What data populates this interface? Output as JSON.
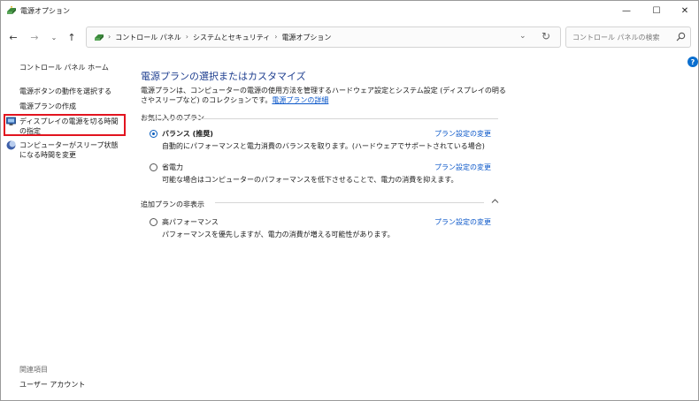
{
  "window": {
    "title": "電源オプション",
    "minimize": "—",
    "maximize": "☐",
    "close": "✕"
  },
  "nav": {
    "back": "←",
    "forward": "→",
    "recent": "⌄",
    "up": "↑",
    "breadcrumbs": [
      "コントロール パネル",
      "システムとセキュリティ",
      "電源オプション"
    ],
    "separator": "›",
    "dropdown": "⌄",
    "refresh": "↻",
    "search_placeholder": "コントロール パネルの検索"
  },
  "help": "?",
  "sidebar": {
    "home": "コントロール パネル ホーム",
    "links": [
      "電源ボタンの動作を選択する",
      "電源プランの作成",
      "ディスプレイの電源を切る時間の指定",
      "コンピューターがスリープ状態になる時間を変更"
    ],
    "related_header": "関連項目",
    "related_links": [
      "ユーザー アカウント"
    ]
  },
  "main": {
    "title": "電源プランの選択またはカスタマイズ",
    "description": "電源プランは、コンピューターの電源の使用方法を管理するハードウェア設定とシステム設定 (ディスプレイの明るさやスリープなど) のコレクションです。",
    "description_link": "電源プランの詳細",
    "favorites_header": "お気に入りのプラン",
    "extra_header": "追加プランの非表示",
    "change_label": "プラン設定の変更",
    "plans": [
      {
        "name": "バランス (推奨)",
        "desc": "自動的にパフォーマンスと電力消費のバランスを取ります。(ハードウェアでサポートされている場合)",
        "selected": true
      },
      {
        "name": "省電力",
        "desc": "可能な場合はコンピューターのパフォーマンスを低下させることで、電力の消費を抑えます。",
        "selected": false
      },
      {
        "name": "高パフォーマンス",
        "desc": "パフォーマンスを優先しますが、電力の消費が増える可能性があります。",
        "selected": false
      }
    ]
  },
  "colors": {
    "title_blue": "#1e3e8f",
    "link_blue": "#0b57c9",
    "highlight_red": "#e2141f",
    "radio_blue": "#0b5fbf"
  }
}
